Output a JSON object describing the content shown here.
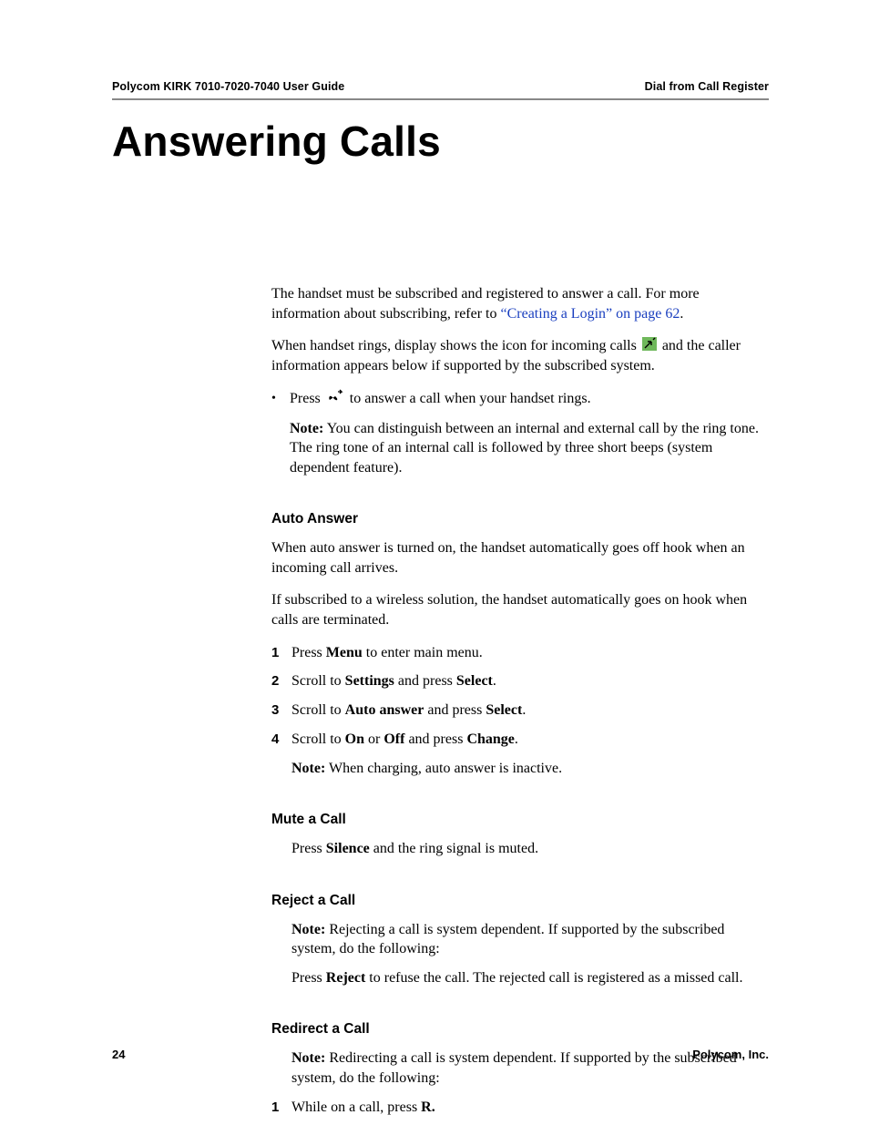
{
  "header": {
    "left": "Polycom KIRK 7010-7020-7040 User Guide",
    "right": "Dial from Call Register"
  },
  "title": "Answering Calls",
  "intro": {
    "p1_a": "The handset must be subscribed and registered to answer a call. For more information about subscribing, refer to ",
    "p1_link": "“Creating a Login” on page 62",
    "p1_b": ".",
    "p2_a": "When handset rings, display shows the icon for incoming calls ",
    "p2_b": " and the caller information appears below if supported by the subscribed system.",
    "bullet_a": "Press ",
    "bullet_b": " to answer a call when your handset rings.",
    "note_prefix": "Note:",
    "note_body": " You can distinguish between an internal and external call by the ring tone. The ring tone of an internal call is followed by three short beeps (system dependent feature)."
  },
  "sections": {
    "auto_answer": {
      "heading": "Auto Answer",
      "p1": "When auto answer is turned on, the handset automatically goes off hook when an incoming call arrives.",
      "p2": "If subscribed to a wireless solution, the handset automatically goes on hook when calls are terminated.",
      "steps": [
        {
          "n": "1",
          "a": "Press ",
          "b1": "Menu",
          "c": " to enter main menu."
        },
        {
          "n": "2",
          "a": "Scroll to ",
          "b1": "Settings",
          "c": " and press ",
          "b2": "Select",
          "d": "."
        },
        {
          "n": "3",
          "a": "Scroll to ",
          "b1": "Auto answer",
          "c": " and press ",
          "b2": "Select",
          "d": "."
        },
        {
          "n": "4",
          "a": "Scroll to ",
          "b1": "On",
          "mid": " or ",
          "b2": "Off",
          "c": " and press ",
          "b3": "Change",
          "d": "."
        }
      ],
      "tail_note_prefix": "Note:",
      "tail_note_body": " When charging, auto answer is inactive."
    },
    "mute": {
      "heading": "Mute a Call",
      "line_a": " Press ",
      "line_b1": "Silence",
      "line_c": " and the ring signal is muted."
    },
    "reject": {
      "heading": "Reject a Call",
      "note_prefix": "Note:",
      "note_body": " Rejecting a call is system dependent. If supported by the subscribed system, do the following:",
      "line_a": " Press ",
      "line_b1": "Reject",
      "line_c": " to refuse the call. The rejected call is registered as a missed call."
    },
    "redirect": {
      "heading": "Redirect a Call",
      "note_prefix": "Note:",
      "note_body": " Redirecting a call is system dependent. If supported by the subscribed system, do the following:",
      "step1_n": "1",
      "step1_a": "While on a call, press ",
      "step1_b": "R."
    }
  },
  "footer": {
    "page": "24",
    "company": "Polycom, Inc."
  }
}
